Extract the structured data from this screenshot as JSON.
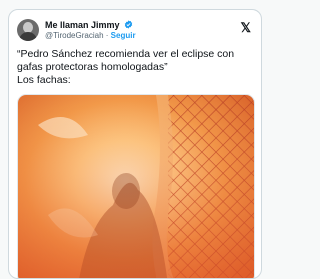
{
  "tweet": {
    "user_name": "Me llaman Jimmy",
    "handle": "@TirodeGraciah",
    "separator": "·",
    "follow_label": "Seguir",
    "text_line1": "“Pedro Sánchez recomienda ver el eclipse con gafas protectoras homologadas”",
    "text_line2": "Los fachas:",
    "platform_icon": "x-logo-icon",
    "verified_icon": "verified-badge-icon"
  },
  "colors": {
    "accent": "#1d9bf0",
    "text": "#0f1419",
    "muted": "#536471"
  },
  "media": {
    "description_icon": "photo"
  }
}
